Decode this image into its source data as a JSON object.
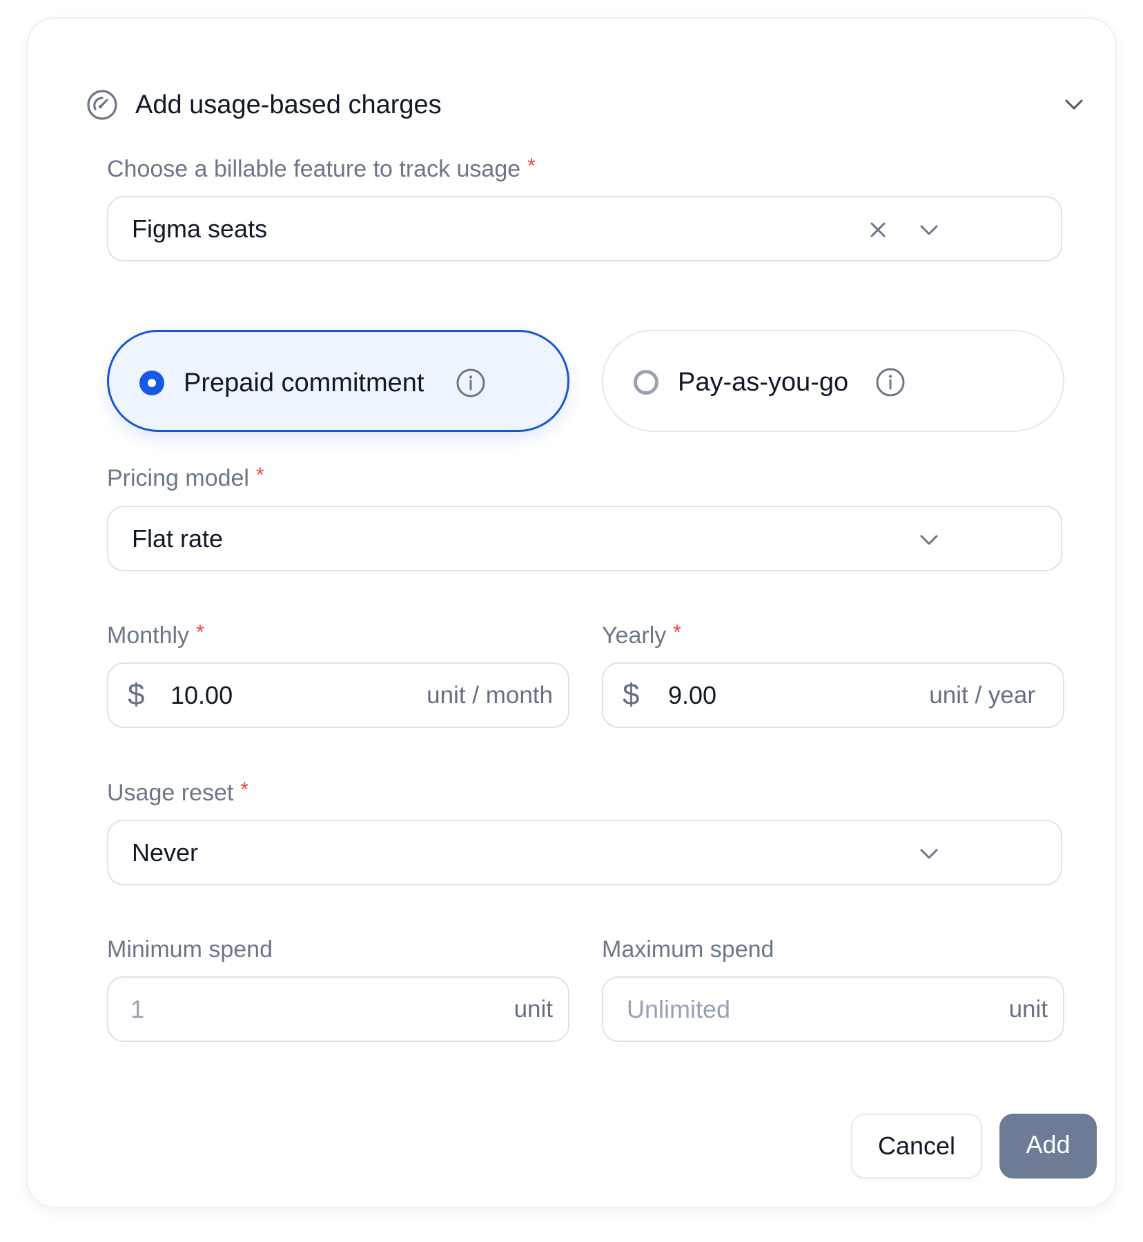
{
  "header": {
    "title": "Add usage-based charges",
    "icon": "gauge-icon",
    "collapse_icon": "chevron-down-icon"
  },
  "feature": {
    "label": "Choose a billable feature to track usage",
    "required": "*",
    "value": "Figma seats"
  },
  "billing_type": {
    "options": [
      {
        "label": "Prepaid commitment",
        "selected": true
      },
      {
        "label": "Pay-as-you-go",
        "selected": false
      }
    ]
  },
  "pricing_model": {
    "label": "Pricing model",
    "required": "*",
    "value": "Flat rate"
  },
  "monthly": {
    "label": "Monthly",
    "required": "*",
    "currency": "$",
    "value": "10.00",
    "unit": "unit / month"
  },
  "yearly": {
    "label": "Yearly",
    "required": "*",
    "currency": "$",
    "value": "9.00",
    "unit": "unit / year"
  },
  "usage_reset": {
    "label": "Usage reset",
    "required": "*",
    "value": "Never"
  },
  "minimum_spend": {
    "label": "Minimum spend",
    "placeholder": "1",
    "unit": "unit"
  },
  "maximum_spend": {
    "label": "Maximum spend",
    "placeholder": "Unlimited",
    "unit": "unit"
  },
  "actions": {
    "cancel": "Cancel",
    "add": "Add"
  },
  "colors": {
    "accent": "#1559e6",
    "selected_bg": "#eef5ff",
    "required": "#ef4444",
    "label": "#6b7789",
    "add_button": "#6e7b94"
  }
}
